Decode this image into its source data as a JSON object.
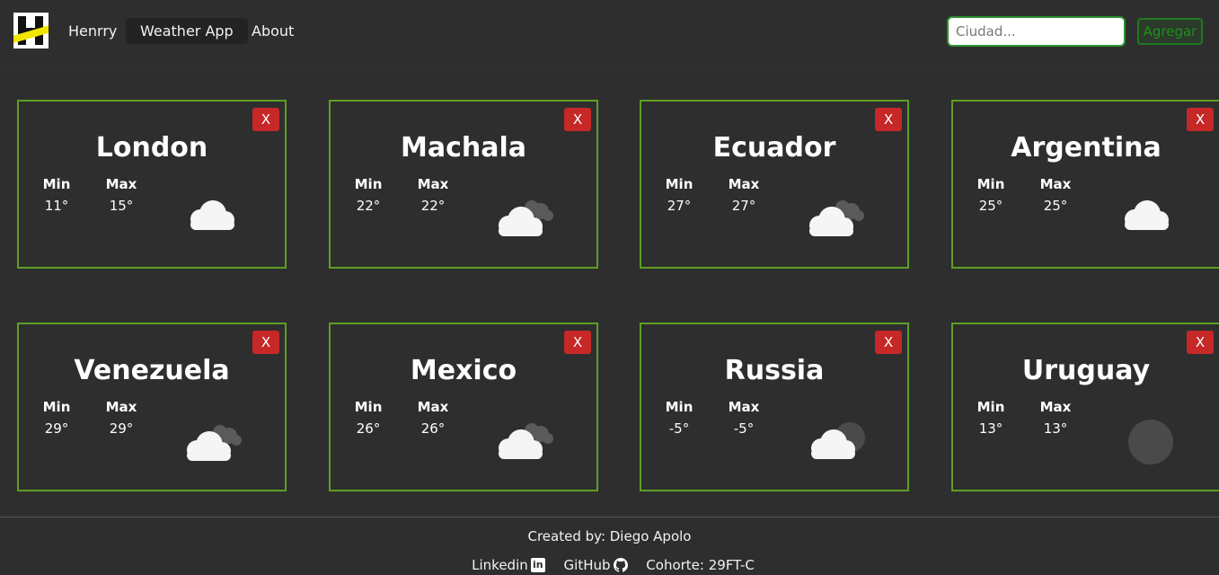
{
  "navbar": {
    "links": [
      {
        "label": "Henrry",
        "active": false
      },
      {
        "label": "Weather App",
        "active": true
      },
      {
        "label": "About",
        "active": false
      }
    ],
    "search_placeholder": "Ciudad...",
    "add_label": "Agregar"
  },
  "cards": [
    {
      "city": "London",
      "min_label": "Min",
      "max_label": "Max",
      "min": "11°",
      "max": "15°",
      "icon": "cloud-icon",
      "close": "X"
    },
    {
      "city": "Machala",
      "min_label": "Min",
      "max_label": "Max",
      "min": "22°",
      "max": "22°",
      "icon": "cloud-dark-cloud-icon",
      "close": "X"
    },
    {
      "city": "Ecuador",
      "min_label": "Min",
      "max_label": "Max",
      "min": "27°",
      "max": "27°",
      "icon": "cloud-dark-cloud-icon",
      "close": "X"
    },
    {
      "city": "Argentina",
      "min_label": "Min",
      "max_label": "Max",
      "min": "25°",
      "max": "25°",
      "icon": "cloud-icon",
      "close": "X"
    },
    {
      "city": "Venezuela",
      "min_label": "Min",
      "max_label": "Max",
      "min": "29°",
      "max": "29°",
      "icon": "cloud-dark-cloud-icon",
      "close": "X"
    },
    {
      "city": "Mexico",
      "min_label": "Min",
      "max_label": "Max",
      "min": "26°",
      "max": "26°",
      "icon": "cloud-dark-cloud-icon",
      "close": "X"
    },
    {
      "city": "Russia",
      "min_label": "Min",
      "max_label": "Max",
      "min": "-5°",
      "max": "-5°",
      "icon": "cloud-night-moon-icon",
      "close": "X"
    },
    {
      "city": "Uruguay",
      "min_label": "Min",
      "max_label": "Max",
      "min": "13°",
      "max": "13°",
      "icon": "night-moon-icon",
      "close": "X"
    }
  ],
  "footer": {
    "credit": "Created by: Diego Apolo",
    "linkedin": "Linkedin",
    "github": "GitHub",
    "cohort": "Cohorte: 29FT-C"
  },
  "colors": {
    "background": "#2e2e2e",
    "card_border": "#5e9e24",
    "close_button": "#c62828",
    "accent_green": "#1f8f1f"
  }
}
